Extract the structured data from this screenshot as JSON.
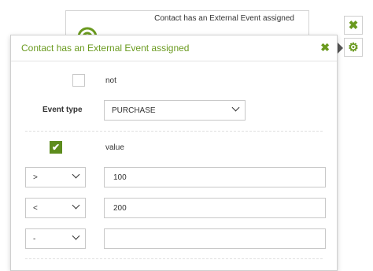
{
  "background_card": {
    "title": "Contact has an External Event assigned"
  },
  "side_buttons": {
    "close_glyph": "✖",
    "gear_glyph": "⚙"
  },
  "panel": {
    "title": "Contact has an External Event assigned",
    "close_glyph": "✖",
    "not_label": "not",
    "event_type_label": "Event type",
    "event_type_value": "PURCHASE",
    "value_label": "value",
    "value_checked": true,
    "check_glyph": "✔",
    "rows": [
      {
        "operator": ">",
        "value": "100"
      },
      {
        "operator": "<",
        "value": "200"
      },
      {
        "operator": "-",
        "value": ""
      }
    ]
  },
  "colors": {
    "accent": "#6a9a1f",
    "checkbox_checked": "#5d8c1d",
    "border": "#c8c8c8"
  }
}
